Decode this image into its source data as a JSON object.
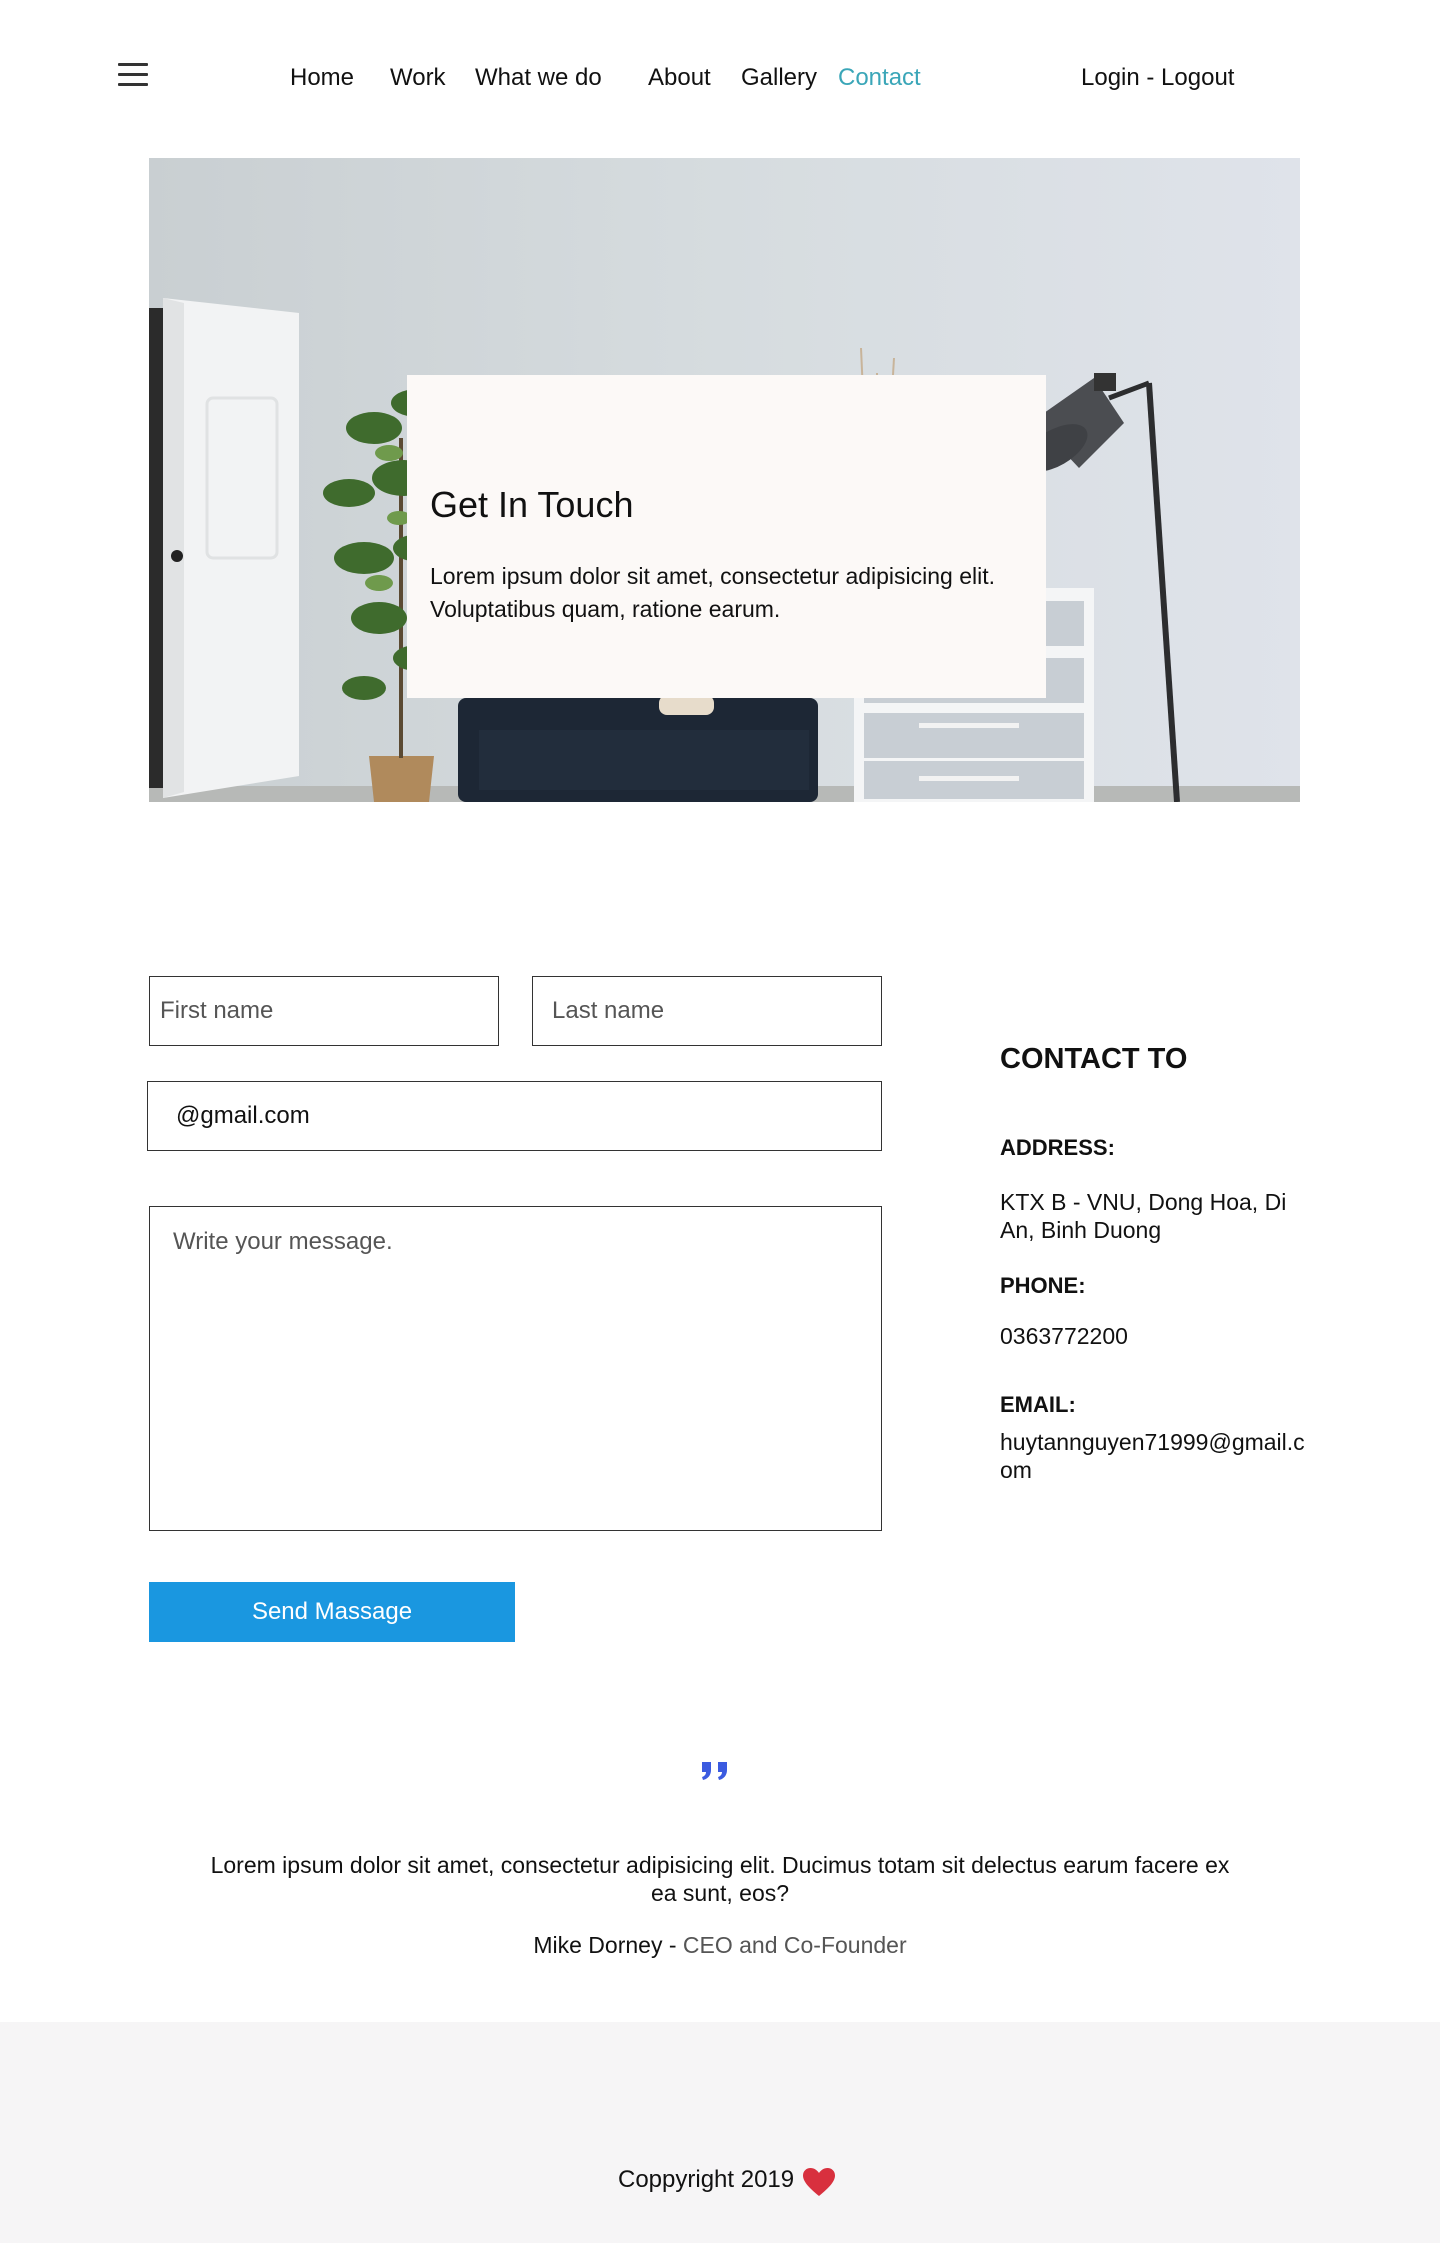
{
  "nav": {
    "items": [
      "Home",
      "Work",
      "What we do",
      "About",
      "Gallery",
      "Contact"
    ],
    "active": "Contact",
    "auth": "Login - Logout"
  },
  "hero": {
    "title": "Get In Touch",
    "text": "Lorem ipsum dolor sit amet, consectetur adipisicing elit. Voluptatibus quam, ratione earum."
  },
  "form": {
    "first_name_placeholder": "First name",
    "last_name_placeholder": "Last name",
    "email_value": "@gmail.com",
    "message_placeholder": "Write your message.",
    "send_label": "Send Massage"
  },
  "contact": {
    "heading": "CONTACT TO",
    "address_label": "ADDRESS:",
    "address_value": "KTX B - VNU, Dong Hoa, Di An, Binh Duong",
    "phone_label": "PHONE:",
    "phone_value": "0363772200",
    "email_label": "EMAIL:",
    "email_value": "huytannguyen71999@gmail.com"
  },
  "quote": {
    "text": "Lorem ipsum dolor sit amet, consectetur adipisicing elit. Ducimus totam sit delectus earum facere ex ea sunt, eos?",
    "author": "Mike Dorney",
    "separator": " - ",
    "role": "CEO and Co-Founder"
  },
  "footer": {
    "copyright": "Coppyright 2019"
  },
  "colors": {
    "accent": "#3aa6b8",
    "button": "#1a97e0",
    "quote_icon": "#3b5be0",
    "heart": "#d8303e",
    "footer_bg": "#f6f5f6"
  },
  "icons": [
    "hamburger-icon",
    "quote-icon",
    "heart-icon"
  ]
}
